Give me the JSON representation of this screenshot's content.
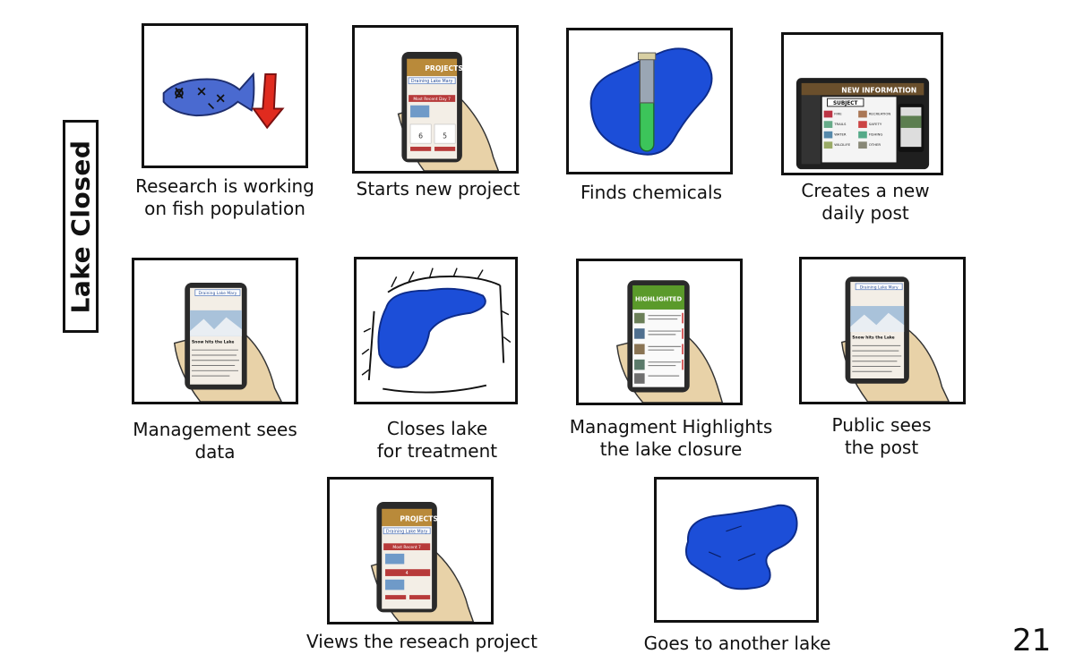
{
  "side_title": "Lake Closed",
  "page_number": "21",
  "panels": [
    {
      "caption": "Research is working\non fish population"
    },
    {
      "caption": "Starts new project",
      "phone_header": "PROJECTS",
      "phone_subtitle": "Draining Lake Mary",
      "phone_section": "Most Recent Day 7",
      "phone_counts": [
        "6",
        "5"
      ]
    },
    {
      "caption": "Finds chemicals"
    },
    {
      "caption": "Creates a new\ndaily post",
      "screen_title": "NEW INFORMATION",
      "screen_subject": "SUBJECT",
      "screen_items": [
        "RECREATION",
        "SAFETY",
        "FISHING",
        "OTHER"
      ],
      "screen_left_items": [
        "FIRE",
        "TRAILS",
        "WATER",
        "WILDLIFE"
      ]
    },
    {
      "caption": "Management sees\ndata",
      "phone_subtitle": "Draining Lake Mary",
      "post_title": "Snow hits the Lake"
    },
    {
      "caption": "Closes lake\nfor treatment"
    },
    {
      "caption": "Managment Highlights\nthe lake closure",
      "phone_header": "HIGHLIGHTED"
    },
    {
      "caption": "Public sees\nthe post",
      "phone_subtitle": "Draining Lake Mary",
      "post_title": "Snow hits the Lake"
    },
    {
      "caption": "Views the reseach project",
      "phone_header": "PROJECTS",
      "phone_subtitle": "Draining Lake Mary",
      "phone_section": "Most Recent 7",
      "phone_counts": [
        "4"
      ]
    },
    {
      "caption": "Goes to another lake"
    }
  ],
  "colors": {
    "lake_blue": "#1c4ed8",
    "fish_blue": "#4a6ad0",
    "arrow_red": "#e02b1f",
    "tube_green": "#3cc45a",
    "hand_skin": "#e8d2a8",
    "phone_dark": "#2a2a2a",
    "header_gold": "#b98a3a",
    "section_red": "#b73a3a",
    "highlight_green": "#5a9a2a"
  }
}
